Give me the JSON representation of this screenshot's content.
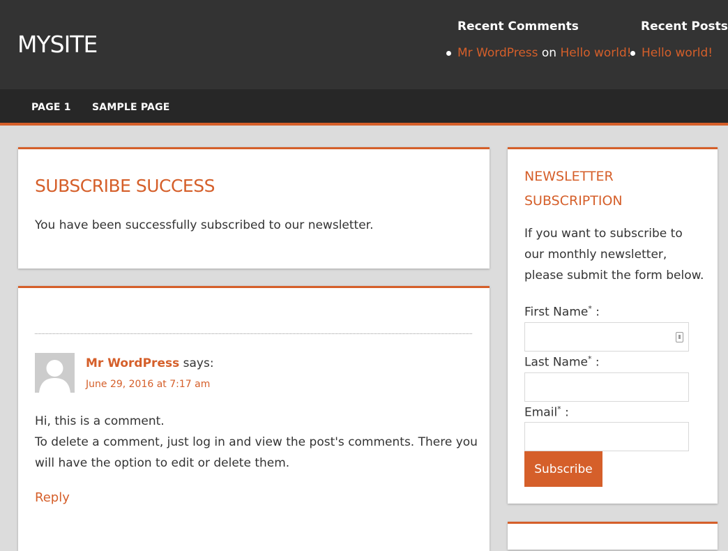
{
  "header": {
    "site_title": "MYSITE",
    "recent_comments": {
      "title": "Recent Comments",
      "author": "Mr WordPress",
      "on": "on",
      "post": "Hello world!"
    },
    "recent_posts": {
      "title": "Recent Posts",
      "post": "Hello world!"
    }
  },
  "nav": {
    "items": [
      {
        "label": "PAGE 1"
      },
      {
        "label": "SAMPLE PAGE"
      }
    ]
  },
  "main": {
    "success": {
      "title": "SUBSCRIBE SUCCESS",
      "text": "You have been successfully subscribed to our newsletter."
    },
    "comment": {
      "author": "Mr WordPress",
      "says": "says:",
      "date": "June 29, 2016 at 7:17 am",
      "line1": "Hi, this is a comment.",
      "line2": "To delete a comment, just log in and view the post's comments. There you will have the option to edit or delete them.",
      "reply": "Reply"
    }
  },
  "sidebar": {
    "newsletter": {
      "title": "NEWSLETTER SUBSCRIPTION",
      "description": "If you want to subscribe to our monthly newsletter, please submit the form below.",
      "first_name_label": "First Name",
      "last_name_label": "Last Name",
      "email_label": "Email",
      "required_mark": "*",
      "colon": " :",
      "first_name_value": "",
      "last_name_value": "",
      "email_value": "",
      "subscribe_label": "Subscribe"
    }
  },
  "colors": {
    "accent": "#d55f2a",
    "header_bg": "#333333",
    "nav_bg": "#272727",
    "page_bg": "#dcdcdc"
  }
}
